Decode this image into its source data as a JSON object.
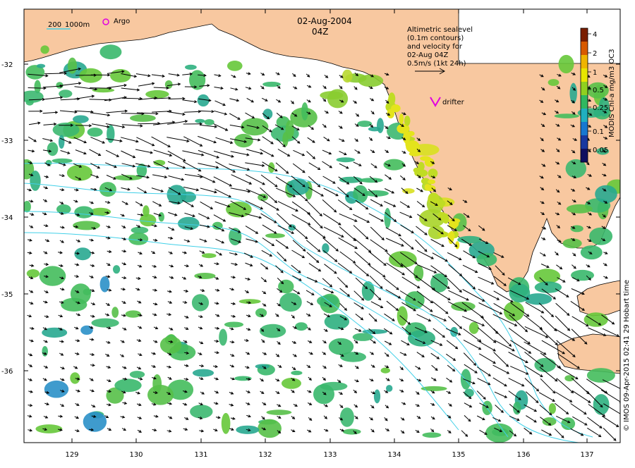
{
  "title": {
    "date": "02-Aug-2004",
    "time": "04Z"
  },
  "scale_bar": {
    "label_200": "200",
    "label_1000": "1000m"
  },
  "legend_items": {
    "argo": "Argo",
    "drifter": "drifter"
  },
  "velocity_note": {
    "line1": "Altimetric sealevel",
    "line2": "(0.1m contours)",
    "line3": "and velocity for",
    "line4": "02-Aug 04Z",
    "line5": "0.5m/s (1kt 24h)"
  },
  "colorbar": {
    "label": "MODIS Chl-a mg/m3 OC3",
    "ticks": [
      "4",
      "2",
      "1",
      "0.5",
      "0.25",
      "0.1",
      "0.05"
    ],
    "colors": [
      "#7a1e00",
      "#d85a00",
      "#f0b400",
      "#e8e600",
      "#90d020",
      "#30b860",
      "#20b0c0",
      "#1878d0",
      "#1838a0",
      "#101060"
    ]
  },
  "axes": {
    "lon_ticks": [
      "129",
      "130",
      "131",
      "132",
      "133",
      "134",
      "135",
      "136",
      "137"
    ],
    "lat_ticks": [
      "-32",
      "-33",
      "-34",
      "-35",
      "-36"
    ]
  },
  "credit": "© IMOS 09-Apr-2015 02:41 29 Hobart time",
  "colors": {
    "land": "#f8c8a0",
    "sea": "#ffffff",
    "contour": "#40d0e8",
    "chl_green": "#40b868",
    "chl_yellow": "#e0e020",
    "argo": "#e000e0",
    "drifter": "#e000e0"
  }
}
